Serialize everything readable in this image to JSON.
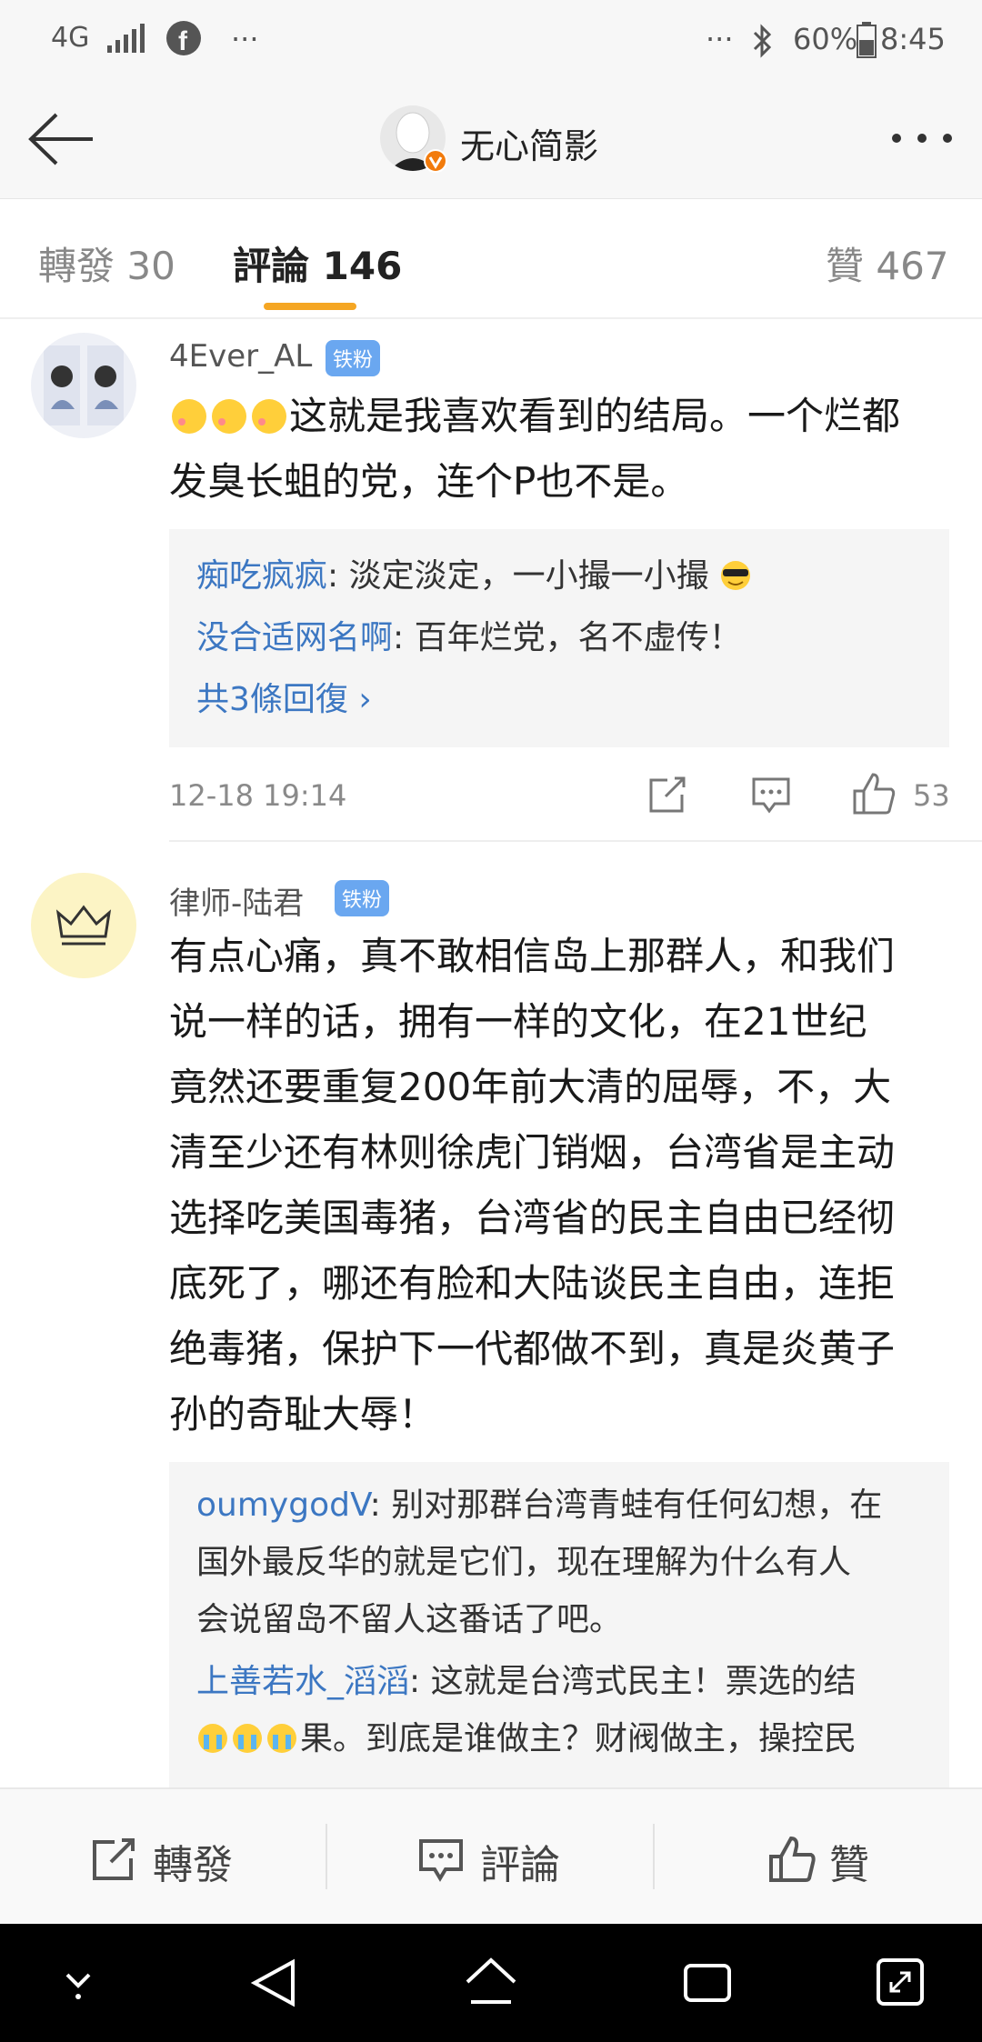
{
  "status_bar": {
    "network": "4G",
    "dots_left": "···",
    "dots_right": "···",
    "battery": "60%",
    "time": "8:45"
  },
  "header": {
    "title": "无心简影"
  },
  "tabs": [
    {
      "label": "轉發 30"
    },
    {
      "label": "評論 146"
    },
    {
      "label": "贊 467"
    }
  ],
  "comments": [
    {
      "username": "4Ever_AL",
      "badge": "铁粉",
      "text_lines": [
        "这就是我喜欢看到的结局。一个烂都",
        "发臭长蛆的党，连个P也不是。"
      ],
      "replies": [
        {
          "name": "痴吃疯疯",
          "text": ": 淡定淡定，一小撮一小撮"
        },
        {
          "name": "没合适网名啊",
          "text": ": 百年烂党，名不虚传！"
        }
      ],
      "more_replies": "共3條回復 ›",
      "time": "12-18 19:14",
      "likes": "53"
    },
    {
      "username": "律师-陆君",
      "badge": "铁粉",
      "text_lines": [
        "有点心痛，真不敢相信岛上那群人，和我们",
        "说一样的话，拥有一样的文化，在21世纪",
        "竟然还要重复200年前大清的屈辱，不，大",
        "清至少还有林则徐虎门销烟，台湾省是主动",
        "选择吃美国毒猪，台湾省的民主自由已经彻",
        "底死了，哪还有脸和大陆谈民主自由，连拒",
        "绝毒猪，保护下一代都做不到，真是炎黄子",
        "孙的奇耻大辱！"
      ],
      "replies": [
        {
          "name": "oumygodV",
          "lines": [
            ": 别对那群台湾青蛙有任何幻想，在",
            "国外最反华的就是它们，现在理解为什么有人",
            "会说留岛不留人这番话了吧。"
          ]
        },
        {
          "name": "上善若水_滔滔",
          "lines": [
            ": 这就是台湾式民主！票选的结",
            "果。到底是谁做主？财阀做主，操控民"
          ]
        }
      ]
    }
  ],
  "bottom_bar": {
    "repost": "轉發",
    "comment": "評論",
    "like": "贊"
  },
  "colors": {
    "accent": "#f5a623",
    "link": "#3c77c2",
    "badge": "#6aa7f0"
  }
}
